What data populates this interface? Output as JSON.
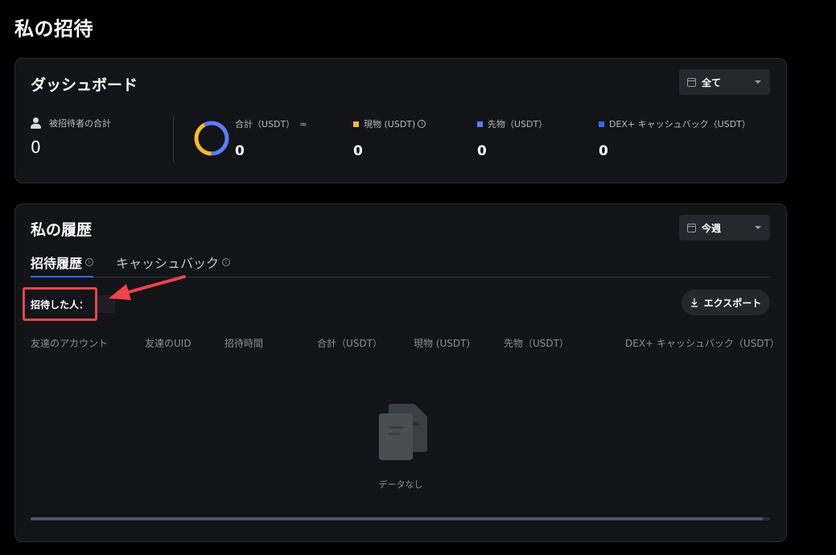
{
  "page": {
    "title": "私の招待"
  },
  "dashboard": {
    "title": "ダッシュボード",
    "filter": {
      "value": "全て",
      "icon": "calendar-icon"
    },
    "invitees": {
      "label": "被招待者の合計",
      "value": "0"
    },
    "total": {
      "label": "合計（USDT）",
      "approx": "≈",
      "value": "0"
    },
    "spot": {
      "label": "現物 (USDT)",
      "value": "0",
      "color": "#f3ba2f"
    },
    "futures": {
      "label": "先物（USDT）",
      "value": "0",
      "color": "#5b7cff"
    },
    "dex": {
      "label": "DEX+ キャッシュバック（USDT）",
      "value": "0",
      "color": "#2f6bff"
    },
    "donut_colors": {
      "blue": "#5b7cff",
      "yellow": "#f3ba2f"
    }
  },
  "history": {
    "title": "私の履歴",
    "filter": {
      "value": "今週",
      "icon": "calendar-icon"
    },
    "tabs": [
      {
        "label": "招待履歴",
        "active": true
      },
      {
        "label": "キャッシュバック",
        "active": false
      }
    ],
    "invited_by_label": "招待した人：",
    "export_label": "エクスポート",
    "columns": [
      "友達のアカウント",
      "友達のUID",
      "招待時間",
      "合計（USDT）",
      "現物 (USDT)",
      "先物（USDT）",
      "DEX+ キャッシュバック（USDT）"
    ],
    "empty_text": "データなし"
  },
  "annotation": {
    "box_color": "#e4474b",
    "arrow_color": "#ee4449"
  }
}
